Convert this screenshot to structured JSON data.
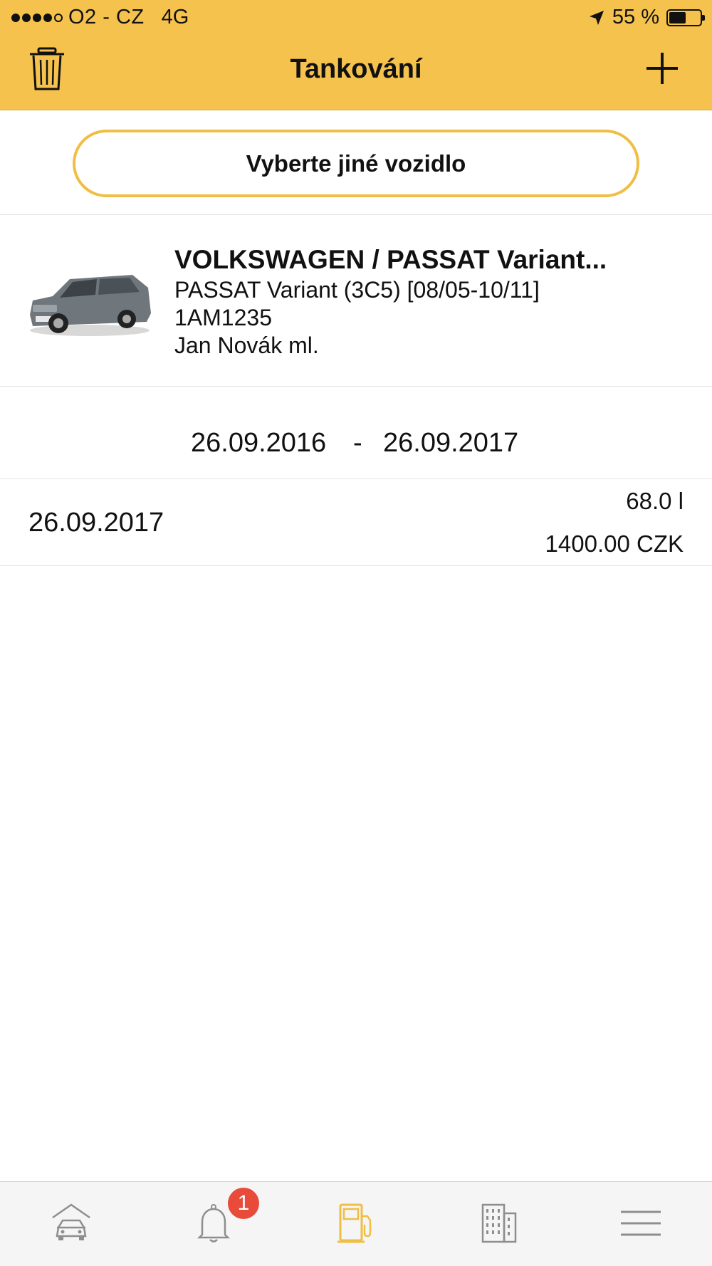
{
  "status_bar": {
    "carrier": "O2 - CZ",
    "network": "4G",
    "battery": "55 %",
    "battery_level": 0.55
  },
  "nav": {
    "title": "Tankování"
  },
  "select_vehicle": {
    "label": "Vyberte jiné vozidlo"
  },
  "vehicle": {
    "title": "VOLKSWAGEN / PASSAT Variant...",
    "model": "PASSAT Variant (3C5) [08/05-10/11]",
    "plate": "1AM1235",
    "owner": "Jan Novák ml."
  },
  "range": {
    "from": "26.09.2016",
    "separator": "-",
    "to": "26.09.2017"
  },
  "entries": [
    {
      "date": "26.09.2017",
      "liters": "68.0 l",
      "price": "1400.00 CZK"
    }
  ],
  "tabbar": {
    "notifications_badge": "1",
    "active": "fuel",
    "colors": {
      "active": "#F0BE45",
      "inactive": "#8e8e8e"
    }
  },
  "colors": {
    "accent": "#F5C24D",
    "badge": "#E84B3A"
  }
}
